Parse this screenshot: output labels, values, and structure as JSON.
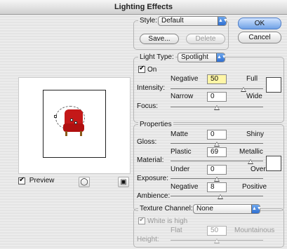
{
  "window": {
    "title": "Lighting Effects"
  },
  "preview": {
    "checkbox_label": "Preview",
    "checked": true,
    "light_icon": "lightbulb-icon",
    "trash_icon": "trash-icon"
  },
  "style": {
    "label": "Style:",
    "value": "Default",
    "save_label": "Save...",
    "delete_label": "Delete",
    "ok_label": "OK",
    "cancel_label": "Cancel"
  },
  "light_type": {
    "title": "Light Type:",
    "value": "Spotlight",
    "on_label": "On",
    "on_checked": true,
    "intensity": {
      "label": "Intensity:",
      "min_label": "Negative",
      "max_label": "Full",
      "value": "50",
      "slider_fraction": 0.66
    },
    "focus": {
      "label": "Focus:",
      "min_label": "Narrow",
      "max_label": "Wide",
      "value": "0",
      "slider_fraction": 0.5
    },
    "color_swatch": "#ffffff"
  },
  "properties": {
    "title": "Properties",
    "gloss": {
      "label": "Gloss:",
      "min_label": "Matte",
      "max_label": "Shiny",
      "value": "0",
      "slider_fraction": 0.5
    },
    "material": {
      "label": "Material:",
      "min_label": "Plastic",
      "max_label": "Metallic",
      "value": "69",
      "slider_fraction": 0.84
    },
    "exposure": {
      "label": "Exposure:",
      "min_label": "Under",
      "max_label": "Over",
      "value": "0",
      "slider_fraction": 0.5
    },
    "ambience": {
      "label": "Ambience:",
      "min_label": "Negative",
      "max_label": "Positive",
      "value": "8",
      "slider_fraction": 0.54
    },
    "color_swatch": "#ffffff"
  },
  "texture": {
    "title": "Texture Channel:",
    "value": "None",
    "white_is_high_label": "White is high",
    "white_is_high_checked": true,
    "height": {
      "label": "Height:",
      "min_label": "Flat",
      "max_label": "Mountainous",
      "value": "50",
      "slider_fraction": 0.5
    }
  },
  "colors": {
    "default_button": "#6fa1e6",
    "intensity_field": "#fff6a6"
  }
}
